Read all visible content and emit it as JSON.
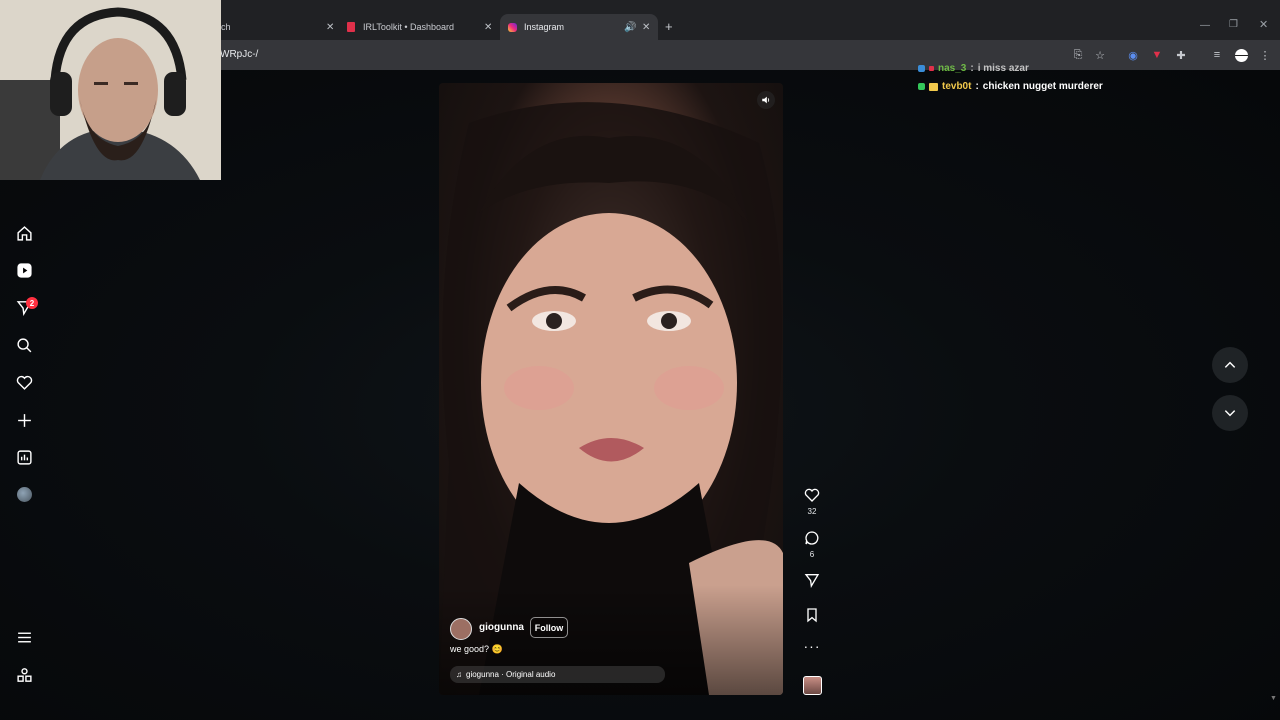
{
  "browser": {
    "tabs": [
      {
        "label": "ch"
      },
      {
        "label": "IRLToolkit • Dashboard"
      },
      {
        "label": "Instagram"
      }
    ],
    "url_fragment": "WRpJc-/"
  },
  "sidebar": {
    "notification_count": "2"
  },
  "reel": {
    "username": "giogunna",
    "follow_label": "Follow",
    "caption": "we good? 😊",
    "audio": "giogunna · Original audio",
    "likes": "32",
    "comments": "6"
  },
  "chat": [
    {
      "user": "nas_3",
      "message": "i miss azar",
      "user_color": "#7bd34a"
    },
    {
      "user": "tevb0t",
      "message": "chicken nugget murderer",
      "user_color": "#f2c94c"
    }
  ],
  "colors": {
    "badge": "#ff3040",
    "page_bg": "#0a0d10"
  }
}
